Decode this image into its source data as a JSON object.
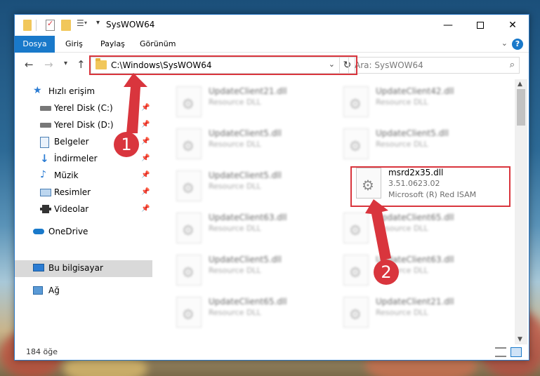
{
  "window": {
    "title": "SysWOW64"
  },
  "ribbon": {
    "tabs": [
      {
        "label": "Dosya",
        "active": true
      },
      {
        "label": "Giriş",
        "active": false
      },
      {
        "label": "Paylaş",
        "active": false
      },
      {
        "label": "Görünüm",
        "active": false
      }
    ],
    "help": "?"
  },
  "navigation": {
    "address": "C:\\Windows\\SysWOW64",
    "search_placeholder": "Ara: SysWOW64"
  },
  "sidebar": {
    "quick_access": "Hızlı erişim",
    "items": [
      {
        "label": "Yerel Disk (C:)",
        "icon": "drive-icon",
        "pinned": true
      },
      {
        "label": "Yerel Disk (D:)",
        "icon": "drive-icon",
        "pinned": true
      },
      {
        "label": "Belgeler",
        "icon": "documents-icon",
        "pinned": true
      },
      {
        "label": "İndirmeler",
        "icon": "downloads-icon",
        "pinned": true
      },
      {
        "label": "Müzik",
        "icon": "music-icon",
        "pinned": true
      },
      {
        "label": "Resimler",
        "icon": "pictures-icon",
        "pinned": true
      },
      {
        "label": "Videolar",
        "icon": "videos-icon",
        "pinned": true
      }
    ],
    "onedrive": "OneDrive",
    "this_pc": "Bu bilgisayar",
    "network": "Ağ"
  },
  "files": {
    "highlighted": {
      "name": "msrd2x35.dll",
      "version": "3.51.0623.02",
      "description": "Microsoft (R) Red ISAM"
    },
    "blurred": [
      {
        "name": "UpdateClient21.dll",
        "type": "Resource DLL"
      },
      {
        "name": "UpdateClient42.dll",
        "type": "Resource DLL"
      },
      {
        "name": "UpdateClient5.dll",
        "type": "Resource DLL"
      },
      {
        "name": "UpdateClient5.dll",
        "type": "Resource DLL"
      },
      {
        "name": "UpdateClient5.dll",
        "type": "Resource DLL"
      },
      {
        "name": "UpdateClient63.dll",
        "type": "Resource DLL"
      },
      {
        "name": "UpdateClient65.dll",
        "type": "Resource DLL"
      },
      {
        "name": "UpdateClient5.dll",
        "type": "Resource DLL"
      },
      {
        "name": "UpdateClient63.dll",
        "type": "Resource DLL"
      },
      {
        "name": "UpdateClient65.dll",
        "type": "Resource DLL"
      },
      {
        "name": "UpdateClient21.dll",
        "type": "Resource DLL"
      }
    ]
  },
  "status": {
    "count": "184 öğe"
  },
  "annotations": {
    "step1": "1",
    "step2": "2",
    "color": "#d9353d"
  }
}
